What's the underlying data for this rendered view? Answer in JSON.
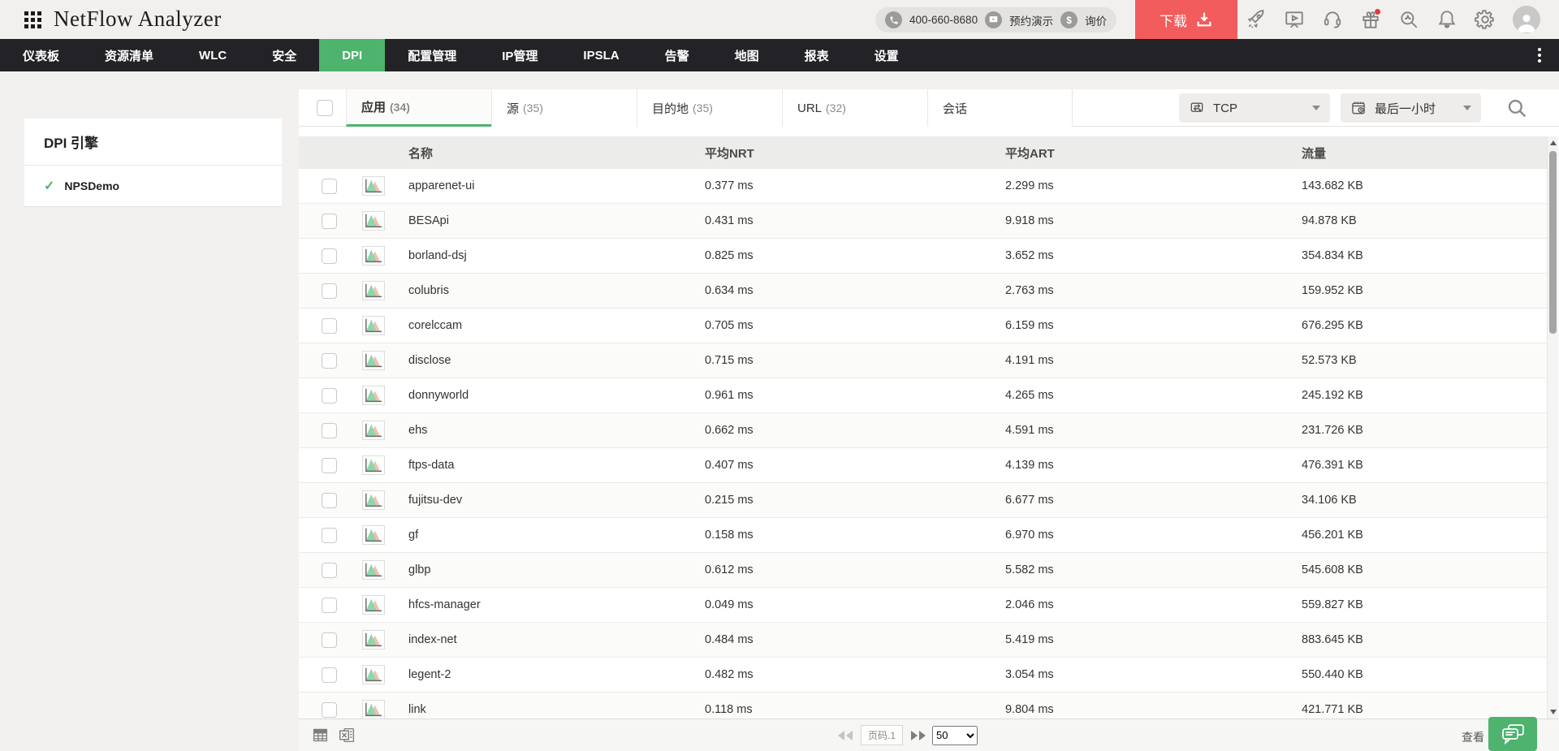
{
  "header": {
    "app_title": "NetFlow Analyzer",
    "phone": "400-660-8680",
    "demo_label": "预约演示",
    "quote_label": "询价",
    "quote_symbol": "$",
    "download_label": "下载"
  },
  "nav": {
    "items": [
      {
        "label": "仪表板"
      },
      {
        "label": "资源清单"
      },
      {
        "label": "WLC"
      },
      {
        "label": "安全"
      },
      {
        "label": "DPI",
        "active": true
      },
      {
        "label": "配置管理"
      },
      {
        "label": "IP管理"
      },
      {
        "label": "IPSLA"
      },
      {
        "label": "告警"
      },
      {
        "label": "地图"
      },
      {
        "label": "报表"
      },
      {
        "label": "设置"
      }
    ]
  },
  "sidebar": {
    "title": "DPI 引擎",
    "engine_name": "NPSDemo",
    "check_glyph": "✓"
  },
  "toolbar": {
    "tabs": [
      {
        "label": "应用",
        "count": "(34)",
        "active": true
      },
      {
        "label": "源",
        "count": "(35)"
      },
      {
        "label": "目的地",
        "count": "(35)"
      },
      {
        "label": "URL",
        "count": "(32)"
      },
      {
        "label": "会话",
        "count": ""
      }
    ],
    "protocol": "TCP",
    "time_range": "最后一小时"
  },
  "table": {
    "columns": {
      "name": "名称",
      "nrt": "平均NRT",
      "art": "平均ART",
      "traffic": "流量"
    },
    "rows": [
      {
        "name": "apparenet-ui",
        "nrt": "0.377 ms",
        "art": "2.299 ms",
        "traffic": "143.682 KB"
      },
      {
        "name": "BESApi",
        "nrt": "0.431 ms",
        "art": "9.918 ms",
        "traffic": "94.878 KB"
      },
      {
        "name": "borland-dsj",
        "nrt": "0.825 ms",
        "art": "3.652 ms",
        "traffic": "354.834 KB"
      },
      {
        "name": "colubris",
        "nrt": "0.634 ms",
        "art": "2.763 ms",
        "traffic": "159.952 KB"
      },
      {
        "name": "corelccam",
        "nrt": "0.705 ms",
        "art": "6.159 ms",
        "traffic": "676.295 KB"
      },
      {
        "name": "disclose",
        "nrt": "0.715 ms",
        "art": "4.191 ms",
        "traffic": "52.573 KB"
      },
      {
        "name": "donnyworld",
        "nrt": "0.961 ms",
        "art": "4.265 ms",
        "traffic": "245.192 KB"
      },
      {
        "name": "ehs",
        "nrt": "0.662 ms",
        "art": "4.591 ms",
        "traffic": "231.726 KB"
      },
      {
        "name": "ftps-data",
        "nrt": "0.407 ms",
        "art": "4.139 ms",
        "traffic": "476.391 KB"
      },
      {
        "name": "fujitsu-dev",
        "nrt": "0.215 ms",
        "art": "6.677 ms",
        "traffic": "34.106 KB"
      },
      {
        "name": "gf",
        "nrt": "0.158 ms",
        "art": "6.970 ms",
        "traffic": "456.201 KB"
      },
      {
        "name": "glbp",
        "nrt": "0.612 ms",
        "art": "5.582 ms",
        "traffic": "545.608 KB"
      },
      {
        "name": "hfcs-manager",
        "nrt": "0.049 ms",
        "art": "2.046 ms",
        "traffic": "559.827 KB"
      },
      {
        "name": "index-net",
        "nrt": "0.484 ms",
        "art": "5.419 ms",
        "traffic": "883.645 KB"
      },
      {
        "name": "legent-2",
        "nrt": "0.482 ms",
        "art": "3.054 ms",
        "traffic": "550.440 KB"
      },
      {
        "name": "link",
        "nrt": "0.118 ms",
        "art": "9.804 ms",
        "traffic": "421.771 KB"
      }
    ]
  },
  "footer": {
    "page_label": "页码.1",
    "page_size": "50",
    "view_label": "查看"
  },
  "colors": {
    "accent_green": "#4db36d",
    "accent_red": "#f25c5c",
    "nav_bg": "#232227"
  }
}
